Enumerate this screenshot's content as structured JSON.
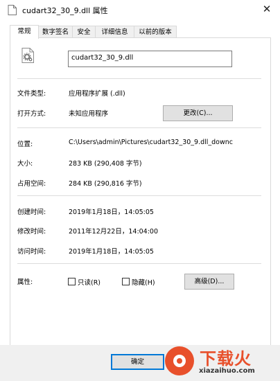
{
  "window": {
    "title": "cudart32_30_9.dll 属性",
    "close_label": "✕"
  },
  "tabs": [
    {
      "label": "常规",
      "active": true
    },
    {
      "label": "数字签名",
      "active": false
    },
    {
      "label": "安全",
      "active": false
    },
    {
      "label": "详细信息",
      "active": false
    },
    {
      "label": "以前的版本",
      "active": false
    }
  ],
  "file": {
    "name": "cudart32_30_9.dll",
    "icon": "dll-gear-file-icon"
  },
  "fields": {
    "type": {
      "label": "文件类型:",
      "value": "应用程序扩展 (.dll)"
    },
    "opens_with": {
      "label": "打开方式:",
      "value": "未知应用程序",
      "button": "更改(C)..."
    },
    "location": {
      "label": "位置:",
      "value": "C:\\Users\\admin\\Pictures\\cudart32_30_9.dll_downc"
    },
    "size": {
      "label": "大小:",
      "value": "283 KB (290,408 字节)"
    },
    "size_on_disk": {
      "label": "占用空间:",
      "value": "284 KB (290,816 字节)"
    },
    "created": {
      "label": "创建时间:",
      "value": "2019年1月18日，14:05:05"
    },
    "modified": {
      "label": "修改时间:",
      "value": "2011年12月22日，14:04:00"
    },
    "accessed": {
      "label": "访问时间:",
      "value": "2019年1月18日，14:05:05"
    },
    "attributes": {
      "label": "属性:",
      "readonly": {
        "label": "只读(R)",
        "checked": false
      },
      "hidden": {
        "label": "隐藏(H)",
        "checked": false
      },
      "advanced": "高级(D)..."
    }
  },
  "buttons": {
    "ok": "确定"
  },
  "watermark": {
    "brand": "下载火",
    "domain": "xiazaihuo.com"
  },
  "colors": {
    "accent": "#0078d7",
    "watermark": "#e8502b"
  }
}
